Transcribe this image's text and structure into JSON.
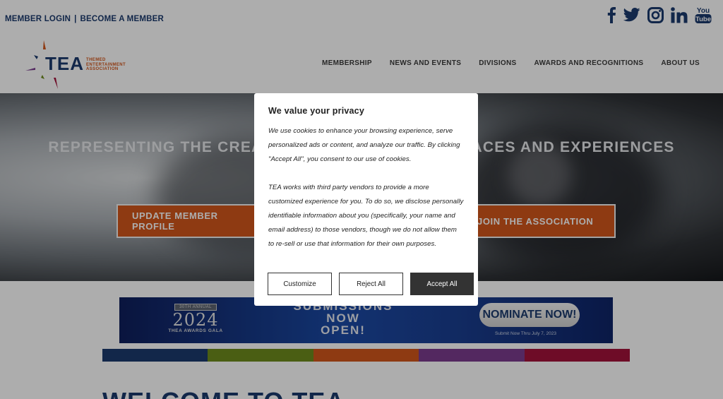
{
  "top_links": {
    "login": "MEMBER LOGIN",
    "separator": "|",
    "become": "BECOME A MEMBER"
  },
  "socials": [
    "facebook-icon",
    "twitter-icon",
    "instagram-icon",
    "linkedin-icon",
    "youtube-icon"
  ],
  "logo": {
    "name": "TEA",
    "tagline_1": "THEMED",
    "tagline_2": "ENTERTAINMENT",
    "tagline_3": "ASSOCIATION"
  },
  "nav": {
    "items": [
      "MEMBERSHIP",
      "NEWS AND EVENTS",
      "DIVISIONS",
      "AWARDS AND RECOGNITIONS",
      "ABOUT US"
    ]
  },
  "hero": {
    "title": "REPRESENTING THE CREATORS OF COMPELLING PLACES AND EXPERIENCES",
    "button_left": "UPDATE MEMBER PROFILE",
    "button_right": "JOIN THE ASSOCIATION"
  },
  "banner": {
    "annual": "30TH ANNUAL",
    "year": "2024",
    "gala": "THEA AWARDS GALA",
    "submissions": "SUBMISSIONS",
    "now": "NOW",
    "open": "OPEN!",
    "nominate": "NOMINATE NOW!",
    "submit_date": "Submit Now Thru July 7, 2023"
  },
  "welcome": "WELCOME TO TEA",
  "colors": {
    "brand_blue": "#1b3a6d",
    "brand_orange": "#d2561b",
    "bar": [
      "#1b3a6d",
      "#6e8b1c",
      "#d2561b",
      "#7b3c8e",
      "#a3123a"
    ]
  },
  "modal": {
    "title": "We value your privacy",
    "paragraph_1": "We use cookies to enhance your browsing experience, serve personalized ads or content, and analyze our traffic. By clicking \"Accept All\", you consent to our use of cookies.",
    "paragraph_2": "TEA works with third party vendors to provide a more customized experience for you. To do so, we disclose personally identifiable information about you (specifically, your name and email address) to those vendors, though we do not allow them to re-sell or use that information for their own purposes.",
    "customize": "Customize",
    "reject": "Reject All",
    "accept": "Accept All"
  }
}
